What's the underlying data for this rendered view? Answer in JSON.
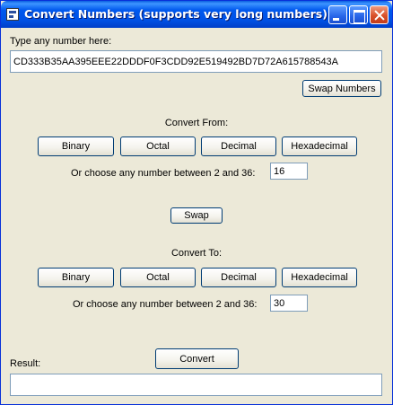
{
  "window": {
    "title": "Convert Numbers (supports very long numbers)"
  },
  "input": {
    "label": "Type any number here:",
    "value": "CD333B35AA395EEE22DDDF0F3CDD92E519492BD7D72A615788543A"
  },
  "swap_numbers_button": "Swap Numbers",
  "convert_from": {
    "heading": "Convert From:",
    "buttons": [
      "Binary",
      "Octal",
      "Decimal",
      "Hexadecimal"
    ],
    "base_label": "Or choose any number between 2 and 36:",
    "base_value": "16"
  },
  "swap_button": "Swap",
  "convert_to": {
    "heading": "Convert To:",
    "buttons": [
      "Binary",
      "Octal",
      "Decimal",
      "Hexadecimal"
    ],
    "base_label": "Or choose any number between 2 and 36:",
    "base_value": "30"
  },
  "convert_button": "Convert",
  "result": {
    "label": "Result:",
    "value": ""
  }
}
